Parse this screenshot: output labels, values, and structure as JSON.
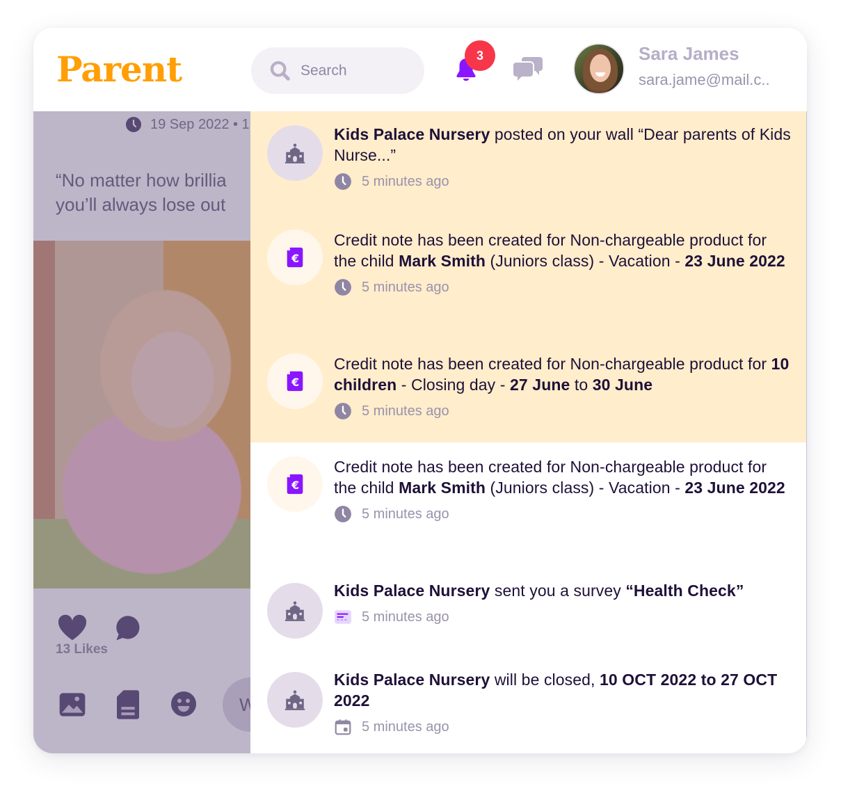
{
  "app": {
    "logo": "Parent",
    "brand_color": "#ff9f05",
    "accent_color": "#8a16ff"
  },
  "header": {
    "search": {
      "placeholder": "Search",
      "value": ""
    },
    "notifications": {
      "badge_count": "3",
      "icon": "bell-icon"
    },
    "messages": {
      "icon": "chat-bubbles-icon"
    },
    "user": {
      "name": "Sara James",
      "email": "sara.jame@mail.c.."
    }
  },
  "post": {
    "date": "19 Sep 2022 • 1",
    "quote_line1": "“No matter how brillia",
    "quote_line2": "you’ll always lose out",
    "likes": "13 Likes",
    "comment_placeholder": "W"
  },
  "notifications": [
    {
      "unread": true,
      "avatar": "school-icon",
      "parts": [
        {
          "b": "Kids Palace Nursery"
        },
        {
          "t": " posted on your wall “Dear parents of Kids Nurse...”"
        }
      ],
      "time_icon": "clock-icon",
      "time": "5 minutes ago"
    },
    {
      "unread": true,
      "avatar": "euro-document-icon",
      "parts": [
        {
          "t": "Credit note has been created for Non-chargeable product for the child "
        },
        {
          "b": "Mark Smith"
        },
        {
          "t": " (Juniors class) - Vacation - "
        },
        {
          "b": "23 June 2022"
        }
      ],
      "time_icon": "clock-icon",
      "time": "5 minutes ago"
    },
    {
      "unread": true,
      "avatar": "euro-document-icon",
      "parts": [
        {
          "t": "Credit note has been created for Non-chargeable product for "
        },
        {
          "b": "10 children"
        },
        {
          "t": " - Closing day - "
        },
        {
          "b": "27 June"
        },
        {
          "t": " to "
        },
        {
          "b": "30 June"
        }
      ],
      "time_icon": "clock-icon",
      "time": "5 minutes ago"
    },
    {
      "unread": false,
      "avatar": "euro-document-icon",
      "parts": [
        {
          "t": "Credit note has been created for Non-chargeable product for the child "
        },
        {
          "b": "Mark Smith"
        },
        {
          "t": " (Juniors class) - Vacation - "
        },
        {
          "b": "23 June 2022"
        }
      ],
      "time_icon": "clock-icon",
      "time": "5 minutes ago"
    },
    {
      "unread": false,
      "avatar": "school-icon",
      "parts": [
        {
          "b": "Kids Palace Nursery"
        },
        {
          "t": " sent you a survey "
        },
        {
          "b": "“Health Check”"
        }
      ],
      "time_icon": "survey-icon",
      "time": "5 minutes ago"
    },
    {
      "unread": false,
      "avatar": "school-icon",
      "parts": [
        {
          "b": "Kids Palace Nursery"
        },
        {
          "t": " will be closed, "
        },
        {
          "b": "10 OCT 2022 to 27 OCT 2022"
        }
      ],
      "time_icon": "calendar-icon",
      "time": "5 minutes ago"
    }
  ]
}
